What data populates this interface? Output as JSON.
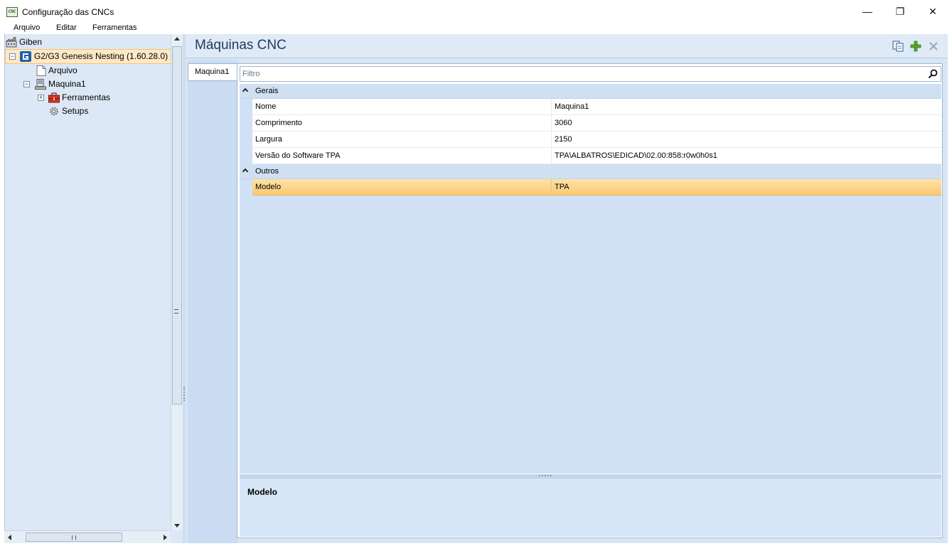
{
  "window": {
    "title": "Configuração das CNCs",
    "app_icon_text": "CNC",
    "minimize": "—",
    "maximize": "❐",
    "close": "✕"
  },
  "menu": [
    "Arquivo",
    "Editar",
    "Ferramentas"
  ],
  "tree": {
    "root": "Giben",
    "product": "G2/G3 Genesis Nesting (1.60.28.0)",
    "items": {
      "arquivo": "Arquivo",
      "maquina": "Maquina1",
      "ferramentas": "Ferramentas",
      "setups": "Setups"
    }
  },
  "content": {
    "title": "Máquinas CNC",
    "tab": "Maquina1",
    "filter_placeholder": "Filtro",
    "categories": [
      {
        "label": "Gerais",
        "rows": [
          {
            "name": "Nome",
            "value": "Maquina1"
          },
          {
            "name": "Comprimento",
            "value": "3060"
          },
          {
            "name": "Largura",
            "value": "2150"
          },
          {
            "name": "Versão do Software TPA",
            "value": "TPA\\ALBATROS\\EDICAD\\02.00:858:r0w0h0s1"
          }
        ]
      },
      {
        "label": "Outros",
        "rows": [
          {
            "name": "Modelo",
            "value": "TPA"
          }
        ]
      }
    ],
    "description_title": "Modelo"
  },
  "colors": {
    "selection": "#fbc874",
    "pane_bg": "#dce8f5",
    "content_bg": "#d7e5f5"
  }
}
